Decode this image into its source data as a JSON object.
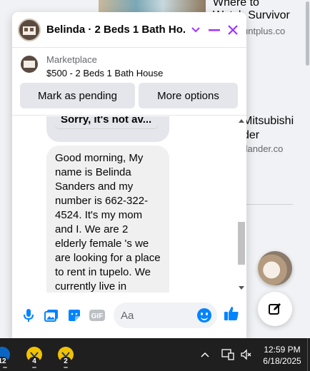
{
  "feed": {
    "post1_title_line1": "Where to",
    "post1_title_line2": "Watch Survivor",
    "post1_domain": "untplus.co",
    "post2_title": "Mitsubishi\nder",
    "post2_domain": "tlander.co"
  },
  "chat": {
    "title": "Belinda · 2 Beds 1 Bath Ho...",
    "listing": {
      "source": "Marketplace",
      "price_title": "$500 - 2 Beds 1 Bath House"
    },
    "buttons": {
      "mark_pending": "Mark as pending",
      "more_options": "More options"
    },
    "messages": {
      "previous": "Sorry, it's not av...",
      "current": "Good morning, My name is Belinda Sanders and my number is 662-322-4524. It's my mom and I. We are 2 elderly female 's we are looking for a place to rent in tupelo. We currently live in Fulton."
    },
    "composer": {
      "placeholder": "Aa"
    }
  },
  "taskbar": {
    "apps": [
      {
        "badge": "12"
      },
      {
        "badge": "4"
      },
      {
        "badge": "2"
      }
    ],
    "time": "12:59 PM",
    "date": "6/18/2025"
  },
  "colors": {
    "accent": "#a033ff",
    "messenger_blue": "#0084ff",
    "taskbar": "#1f1f1f"
  }
}
